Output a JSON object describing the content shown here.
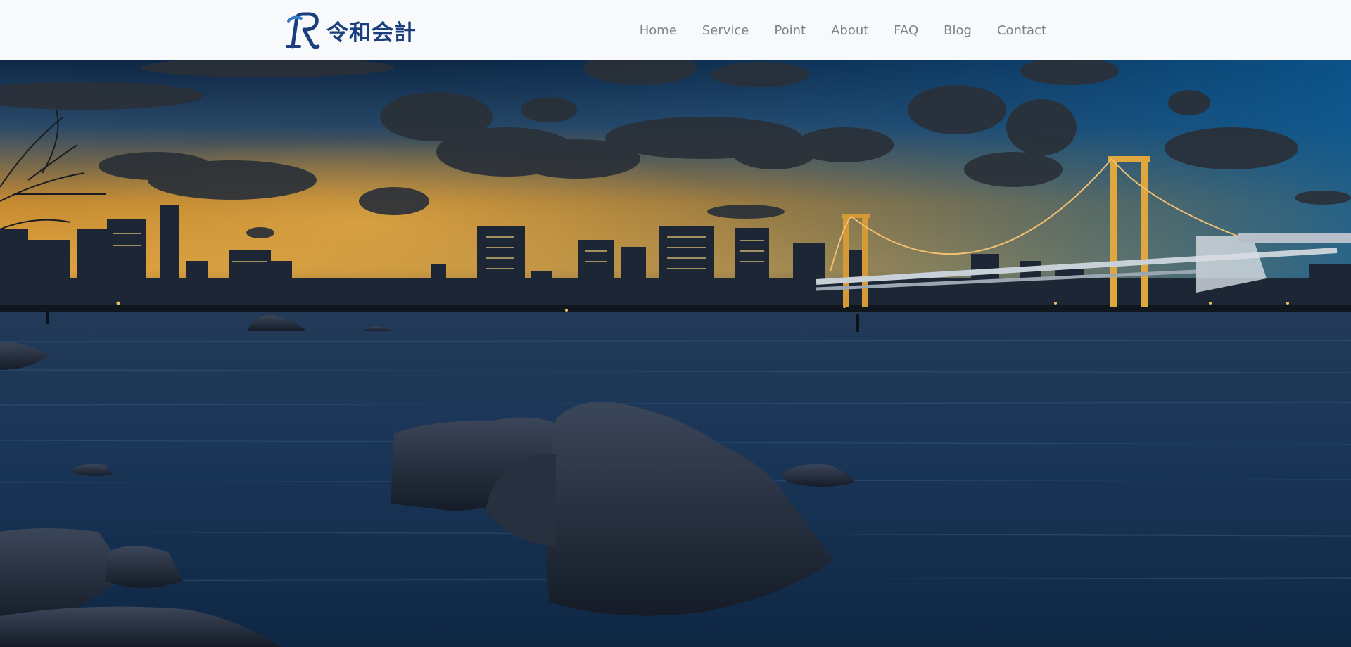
{
  "header": {
    "logo_text": "令和会計",
    "logo_icon": "r-monogram-logo"
  },
  "nav": {
    "items": [
      {
        "label": "Home"
      },
      {
        "label": "Service"
      },
      {
        "label": "Point"
      },
      {
        "label": "About"
      },
      {
        "label": "FAQ"
      },
      {
        "label": "Blog"
      },
      {
        "label": "Contact"
      }
    ]
  },
  "hero": {
    "image": "city-skyline-bridge-at-dusk-over-water-with-rocks"
  },
  "colors": {
    "header_bg": "#f8f9fb",
    "brand": "#1b3f7c",
    "brand_light": "#3a7bc8",
    "nav_text": "#7d8188"
  }
}
